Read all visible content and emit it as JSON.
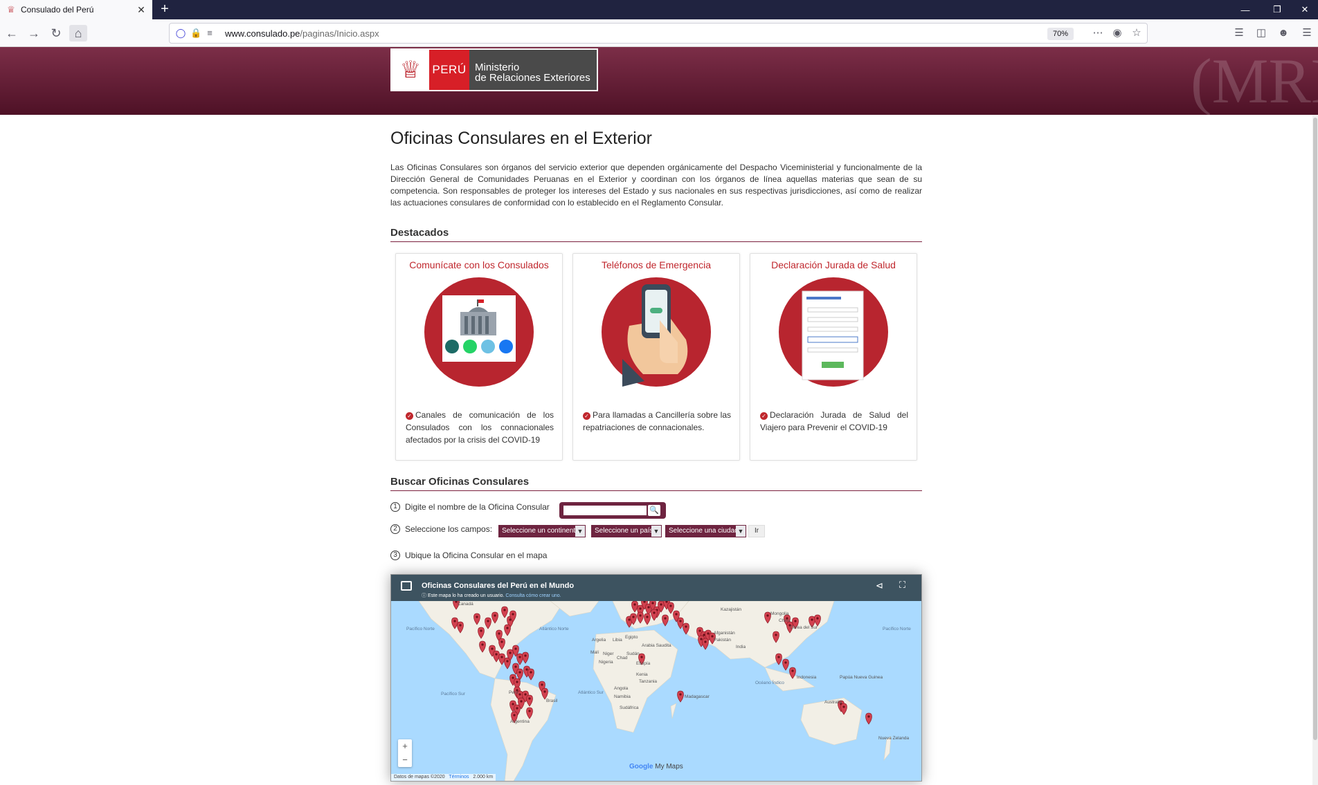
{
  "browser": {
    "tab_title": "Consulado del Perú",
    "url_domain": "www.consulado.pe",
    "url_path": "/paginas/Inicio.aspx",
    "zoom": "70%"
  },
  "header": {
    "logo_peru": "PERÚ",
    "logo_ministry_line1": "Ministerio",
    "logo_ministry_line2": "de Relaciones Exteriores",
    "watermark": "(MRE)"
  },
  "page": {
    "title": "Oficinas Consulares en el Exterior",
    "intro": "Las Oficinas Consulares son órganos del servicio exterior que dependen orgánicamente del Despacho Viceministerial y funcionalmente de la Dirección General de Comunidades Peruanas en el Exterior y coordinan con los órganos de línea aquellas materias que sean de su competencia. Son responsables de proteger los intereses del Estado y sus nacionales en sus respectivas jurisdicciones, así como de realizar las actuaciones consulares de conformidad con lo establecido en el Reglamento Consular."
  },
  "destacados": {
    "heading": "Destacados",
    "cards": [
      {
        "title": "Comunícate con los Consulados",
        "text": "Canales de comunicación de los Consulados con los connacionales afectados por la crisis del COVID-19"
      },
      {
        "title": "Teléfonos de Emergencia",
        "text": "Para llamadas a Cancillería sobre las repatriaciones de connacionales."
      },
      {
        "title": "Declaración Jurada de Salud",
        "text": "Declaración Jurada de Salud del Viajero para Prevenir el COVID-19"
      }
    ]
  },
  "buscar": {
    "heading": "Buscar Oficinas Consulares",
    "step1_num": "1",
    "step1": "Digite el nombre de la Oficina Consular",
    "step2_num": "2",
    "step2": "Seleccione los campos:",
    "step3_num": "3",
    "step3": "Ubique la Oficina Consular en el mapa",
    "select_continent": "Seleccione un continente",
    "select_country": "Seleccione un país",
    "select_city": "Seleccione una ciudad",
    "go_label": "Ir"
  },
  "map": {
    "title": "Oficinas Consulares del Perú en el Mundo",
    "subtitle": "Este mapa lo ha creado un usuario.",
    "subtitle_link": "Consulta cómo crear uno.",
    "brand_google": "Google",
    "brand_mymaps": "My Maps",
    "attribution": "Datos de mapas ©2020",
    "terms": "Términos",
    "scale": "2.000 km",
    "labels": [
      "Canadá",
      "Pacífico Norte",
      "Atlántico Norte",
      "Pacífico Norte",
      "Kazajistán",
      "Mongolia",
      "China",
      "Argelia",
      "Libia",
      "Egipto",
      "Arabia Saudita",
      "Afganistán",
      "Pakistán",
      "India",
      "Corea del Sur",
      "Malí",
      "Niger",
      "Chad",
      "Sudán",
      "Etiopía",
      "Nigeria",
      "Kenia",
      "Tanzania",
      "Angola",
      "Namibia",
      "Madagascar",
      "Sudáfrica",
      "Brasil",
      "Perú",
      "Argentina",
      "Pacífico Sur",
      "Atlántico Sur",
      "Océano Índico",
      "Indonesia",
      "Papúa Nueva Guinea",
      "Australia",
      "Nueva Zelanda"
    ]
  },
  "colors": {
    "brand_maroon": "#6e2440",
    "accent_red": "#c0272d",
    "map_water": "#aadaff",
    "map_land": "#f2efe6"
  }
}
